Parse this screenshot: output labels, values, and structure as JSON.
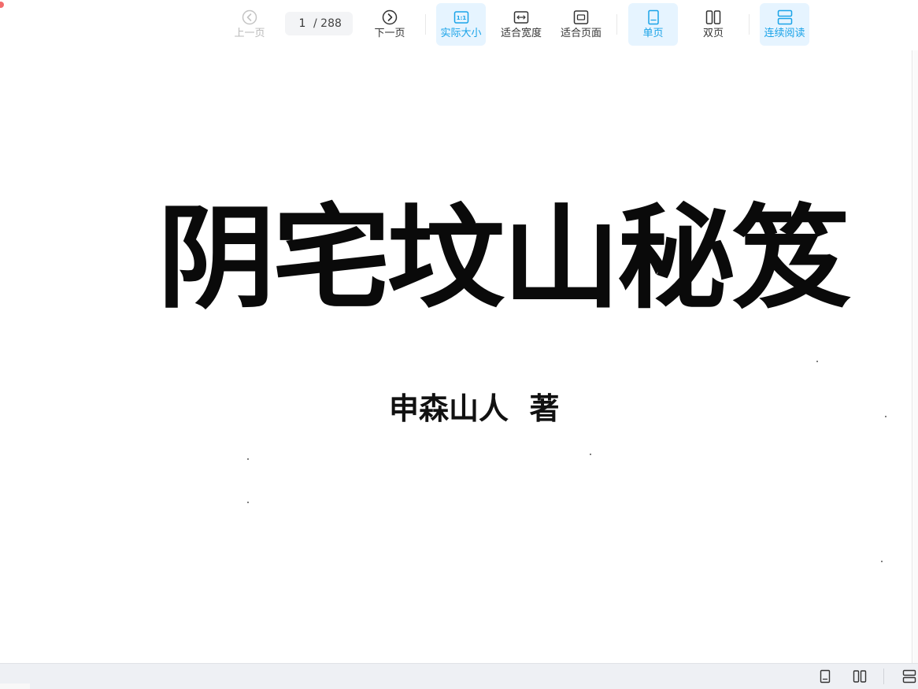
{
  "toolbar": {
    "prev_label": "上一页",
    "page_current": "1",
    "page_total": "/ 288",
    "next_label": "下一页",
    "actual_size_label": "实际大小",
    "actual_size_badge": "1:1",
    "fit_width_label": "适合宽度",
    "fit_page_label": "适合页面",
    "single_page_label": "单页",
    "double_page_label": "双页",
    "continuous_label": "连续阅读",
    "edge_glyph": "≡"
  },
  "document": {
    "title": "阴宅坟山秘笈",
    "author": "申森山人  著"
  },
  "colors": {
    "accent": "#1aa3e8",
    "active_bg": "#e6f4ff",
    "disabled_text": "#b9b9b9",
    "statusbar_bg": "#eef0f4"
  }
}
